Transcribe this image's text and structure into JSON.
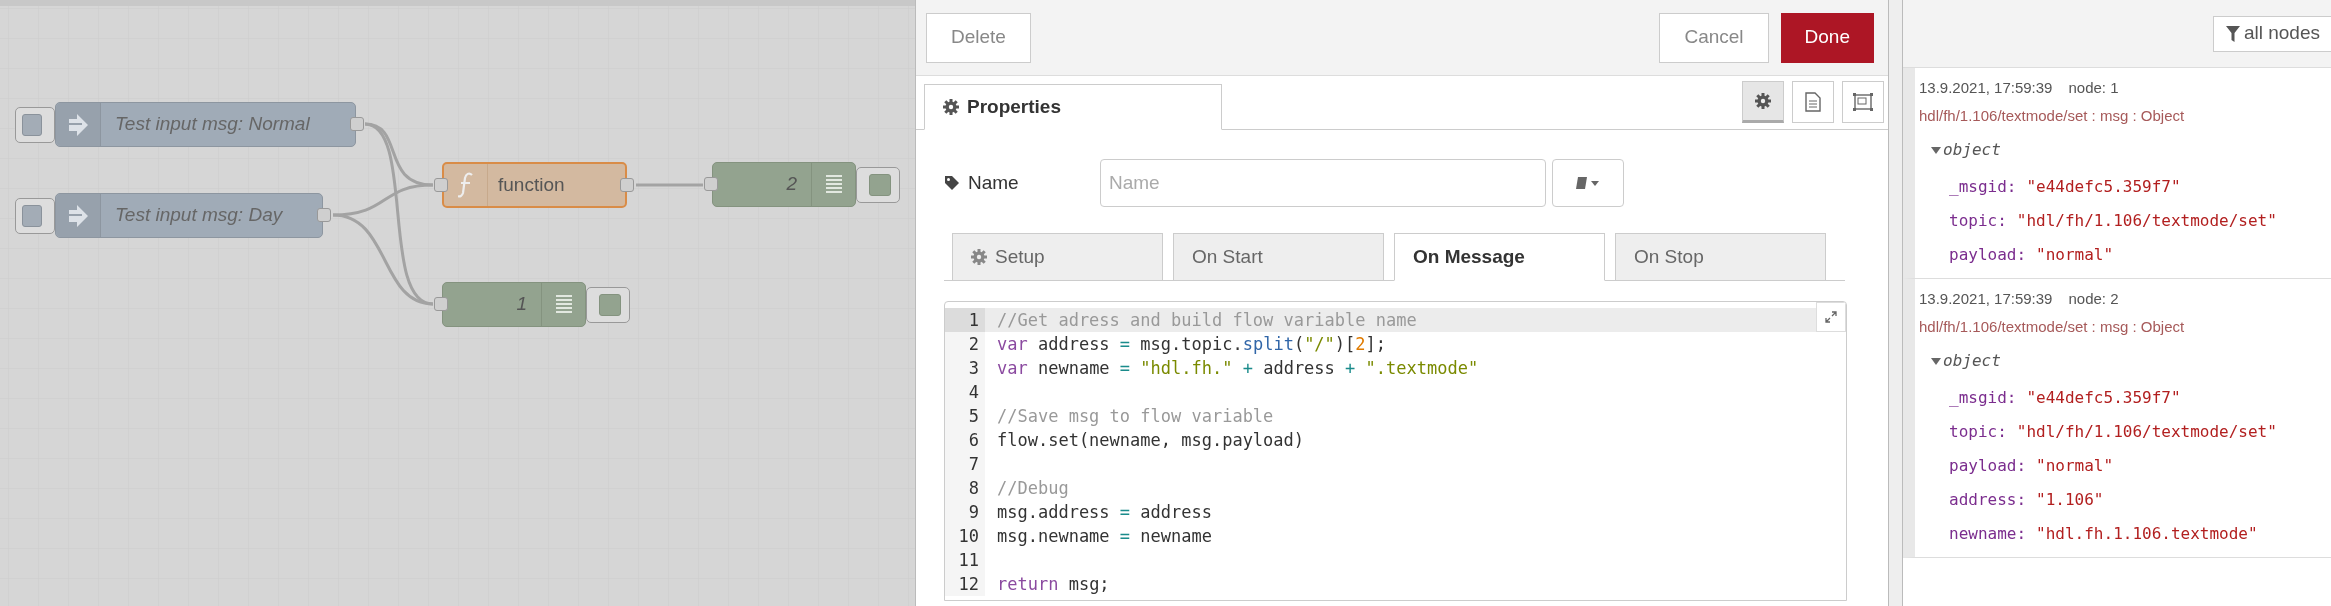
{
  "canvas": {
    "nodes": [
      {
        "kind": "inject",
        "label": "Test input msg: Normal"
      },
      {
        "kind": "inject",
        "label": "Test input msg: Day"
      },
      {
        "kind": "function",
        "label": "function"
      },
      {
        "kind": "debug",
        "label": "2"
      },
      {
        "kind": "debug",
        "label": "1"
      }
    ]
  },
  "editor": {
    "buttons": {
      "delete": "Delete",
      "cancel": "Cancel",
      "done": "Done"
    },
    "panel_tab": {
      "label": "Properties",
      "selected": true
    },
    "side_buttons": [
      {
        "selected": true
      },
      {
        "selected": false
      },
      {
        "selected": false
      }
    ],
    "name_field": {
      "label": "Name",
      "placeholder": "Name"
    },
    "tabs": [
      {
        "label": "Setup",
        "selected": false
      },
      {
        "label": "On Start",
        "selected": false
      },
      {
        "label": "On Message",
        "selected": true
      },
      {
        "label": "On Stop",
        "selected": false
      }
    ],
    "code": [
      {
        "number": "1",
        "active": true,
        "tokens": [
          {
            "kind": "comment",
            "text": "//Get adress and build flow variable name"
          }
        ]
      },
      {
        "number": "2",
        "active": false,
        "tokens": [
          {
            "kind": "keyword",
            "text": "var"
          },
          {
            "kind": "plain",
            "text": " address "
          },
          {
            "kind": "operator",
            "text": "= "
          },
          {
            "kind": "plain",
            "text": "msg.topic."
          },
          {
            "kind": "method",
            "text": "split"
          },
          {
            "kind": "plain",
            "text": "("
          },
          {
            "kind": "string",
            "text": "\"/\""
          },
          {
            "kind": "plain",
            "text": ")["
          },
          {
            "kind": "number",
            "text": "2"
          },
          {
            "kind": "plain",
            "text": "];"
          }
        ]
      },
      {
        "number": "3",
        "active": false,
        "tokens": [
          {
            "kind": "keyword",
            "text": "var"
          },
          {
            "kind": "plain",
            "text": " newname "
          },
          {
            "kind": "operator",
            "text": "= "
          },
          {
            "kind": "string",
            "text": "\"hdl.fh.\""
          },
          {
            "kind": "operator",
            "text": " + "
          },
          {
            "kind": "plain",
            "text": "address "
          },
          {
            "kind": "operator",
            "text": "+ "
          },
          {
            "kind": "string",
            "text": "\".textmode\""
          }
        ]
      },
      {
        "number": "4",
        "active": false
      },
      {
        "number": "5",
        "active": false,
        "tokens": [
          {
            "kind": "comment",
            "text": "//Save msg to flow variable"
          }
        ]
      },
      {
        "number": "6",
        "active": false,
        "tokens": [
          {
            "kind": "plain",
            "text": "flow.set(newname, msg.payload)"
          }
        ]
      },
      {
        "number": "7",
        "active": false
      },
      {
        "number": "8",
        "active": false,
        "tokens": [
          {
            "kind": "comment",
            "text": "//Debug"
          }
        ]
      },
      {
        "number": "9",
        "active": false,
        "tokens": [
          {
            "kind": "plain",
            "text": "msg.address "
          },
          {
            "kind": "operator",
            "text": "="
          },
          {
            "kind": "plain",
            "text": " address"
          }
        ]
      },
      {
        "number": "10",
        "active": false,
        "tokens": [
          {
            "kind": "plain",
            "text": "msg.newname "
          },
          {
            "kind": "operator",
            "text": "="
          },
          {
            "kind": "plain",
            "text": " newname"
          }
        ]
      },
      {
        "number": "11",
        "active": false
      },
      {
        "number": "12",
        "active": false,
        "tokens": [
          {
            "kind": "keyword",
            "text": "return"
          },
          {
            "kind": "plain",
            "text": " msg;"
          }
        ]
      }
    ]
  },
  "debug": {
    "filter": "all nodes",
    "messages": [
      {
        "time": "13.9.2021, 17:59:39",
        "node": "node: 1",
        "topic": "hdl/fh/1.106/textmode/set : msg : Object",
        "object": "object",
        "expanded": true,
        "properties": [
          {
            "key": "_msgid:",
            "value": "\"e44defc5.359f7\""
          },
          {
            "key": "topic:",
            "value": "\"hdl/fh/1.106/textmode/set\""
          },
          {
            "key": "payload:",
            "value": "\"normal\""
          }
        ]
      },
      {
        "time": "13.9.2021, 17:59:39",
        "node": "node: 2",
        "topic": "hdl/fh/1.106/textmode/set : msg : Object",
        "object": "object",
        "expanded": true,
        "properties": [
          {
            "key": "_msgid:",
            "value": "\"e44defc5.359f7\""
          },
          {
            "key": "topic:",
            "value": "\"hdl/fh/1.106/textmode/set\""
          },
          {
            "key": "payload:",
            "value": "\"normal\""
          },
          {
            "key": "address:",
            "value": "\"1.106\""
          },
          {
            "key": "newname:",
            "value": "\"hdl.fh.1.106.textmode\""
          }
        ]
      }
    ]
  }
}
